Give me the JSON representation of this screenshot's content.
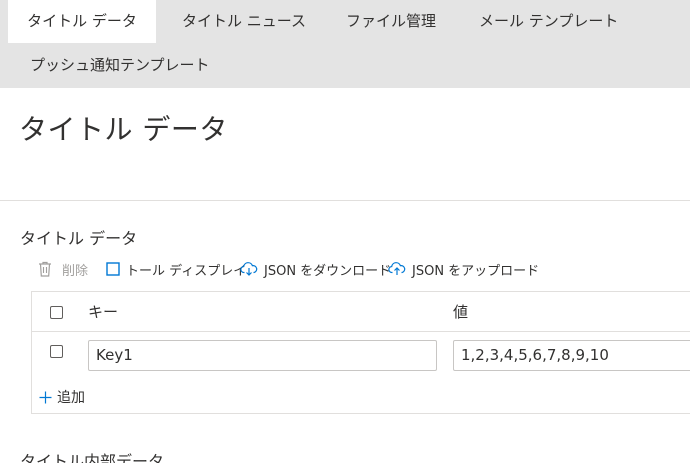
{
  "tabs": [
    {
      "label": "タイトル データ",
      "active": true
    },
    {
      "label": "タイトル ニュース",
      "active": false
    },
    {
      "label": "ファイル管理",
      "active": false
    },
    {
      "label": "メール テンプレート",
      "active": false
    },
    {
      "label": "プッシュ通知テンプレート",
      "active": false
    }
  ],
  "page": {
    "title": "タイトル データ"
  },
  "section": {
    "title": "タイトル データ",
    "toolbar": {
      "delete_label": "削除",
      "toggle_display_label": "トール ディスプレイ",
      "download_json_label": "JSON をダウンロード",
      "upload_json_label": "JSON をアップロード"
    },
    "table": {
      "columns": [
        "キー",
        "値"
      ],
      "rows": [
        {
          "key": "Key1",
          "value": "1,2,3,4,5,6,7,8,9,10"
        }
      ],
      "add_label": "追加"
    }
  },
  "section2": {
    "title": "タイトル内部データ"
  },
  "colors": {
    "accent": "#0078d4",
    "tabbar_bg": "#e4e4e4",
    "disabled": "#a19f9d"
  },
  "icons": {
    "delete": "trash-icon",
    "toggle": "checkbox-icon",
    "download": "cloud-download-icon",
    "upload": "cloud-upload-icon",
    "add": "plus-icon"
  }
}
